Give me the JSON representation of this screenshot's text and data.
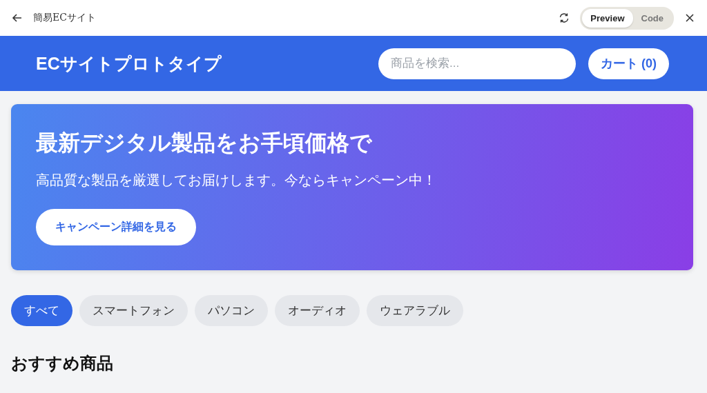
{
  "window": {
    "title": "簡易ECサイト",
    "view_toggle": [
      {
        "label": "Preview",
        "selected": true
      },
      {
        "label": "Code",
        "selected": false
      }
    ]
  },
  "header": {
    "site_title": "ECサイトプロトタイプ",
    "search": {
      "placeholder": "商品を検索..."
    },
    "cart_button": "カート (0)"
  },
  "banner": {
    "title": "最新デジタル製品をお手頃価格で",
    "subtitle": "高品質な製品を厳選してお届けします。今ならキャンペーン中！",
    "button": "キャンペーン詳細を見る"
  },
  "categories": [
    {
      "label": "すべて",
      "selected": true
    },
    {
      "label": "スマートフォン",
      "selected": false
    },
    {
      "label": "パソコン",
      "selected": false
    },
    {
      "label": "オーディオ",
      "selected": false
    },
    {
      "label": "ウェアラブル",
      "selected": false
    }
  ],
  "section_title": "おすすめ商品"
}
